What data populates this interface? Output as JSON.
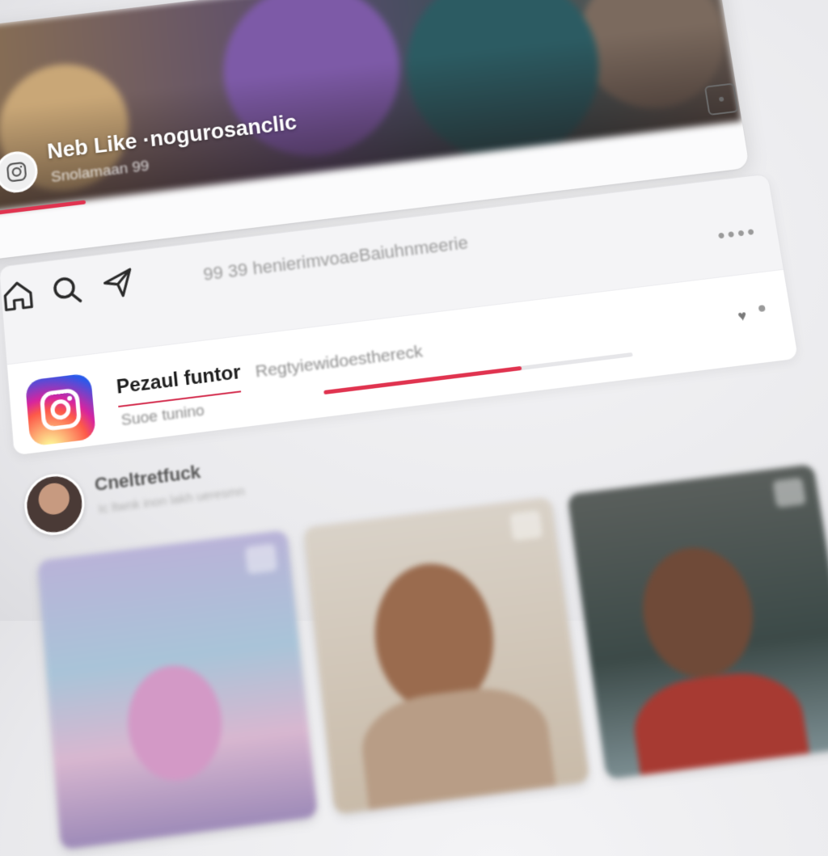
{
  "app": {
    "name": "Instagram"
  },
  "story": {
    "title": "Neb Like ·nogurosanclic",
    "subtitle": "Snolamaan 99",
    "progress": 0.14,
    "menu": "•••"
  },
  "nav": {
    "items": [
      "home-icon",
      "search-icon",
      "send-icon"
    ],
    "caption": "99 39 henierimvoaeBaiuhnmeerie"
  },
  "panel": {
    "menu": "••••",
    "brand_name": "Pezaul funtor",
    "brand_sub": "Suoe tunino",
    "register_text": "Regtyiewidoesthereck",
    "progress": 0.64,
    "heart_glyph": "♥"
  },
  "create": {
    "title": "Cneltretfuck",
    "subtitle": "Ic ltwnk inon lakh ueresmn"
  },
  "colors": {
    "accent": "#e0334f",
    "background": "#f4f4f6"
  }
}
